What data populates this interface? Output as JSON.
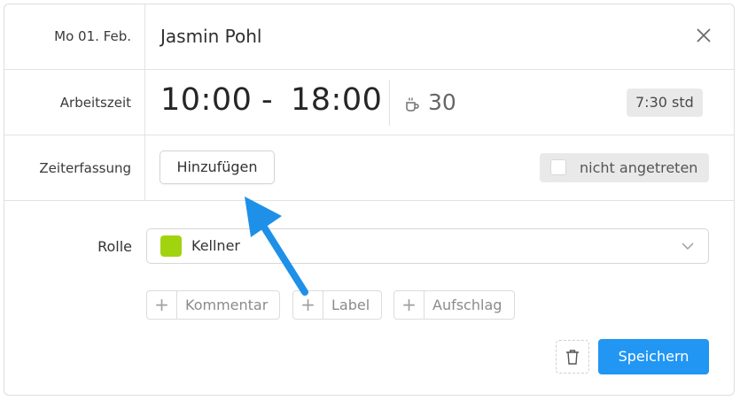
{
  "header": {
    "date": "Mo 01. Feb.",
    "employee_name": "Jasmin Pohl",
    "close_icon": "close-icon"
  },
  "work_time": {
    "label": "Arbeitszeit",
    "start": "10:00",
    "separator": "-",
    "end": "18:00",
    "break_icon": "coffee-cup-icon",
    "break_minutes": "30",
    "duration": "7:30 std"
  },
  "time_tracking": {
    "label": "Zeiterfassung",
    "add_button": "Hinzufügen",
    "absent_label": "nicht angetreten"
  },
  "role": {
    "label": "Rolle",
    "value": "Kellner",
    "color": "#a2d30f"
  },
  "extras": [
    {
      "label": "Kommentar"
    },
    {
      "label": "Label"
    },
    {
      "label": "Aufschlag"
    }
  ],
  "footer": {
    "delete_icon": "trash-icon",
    "save_button": "Speichern"
  },
  "colors": {
    "primary": "#2196f3",
    "annotation_arrow": "#1e90e8"
  }
}
